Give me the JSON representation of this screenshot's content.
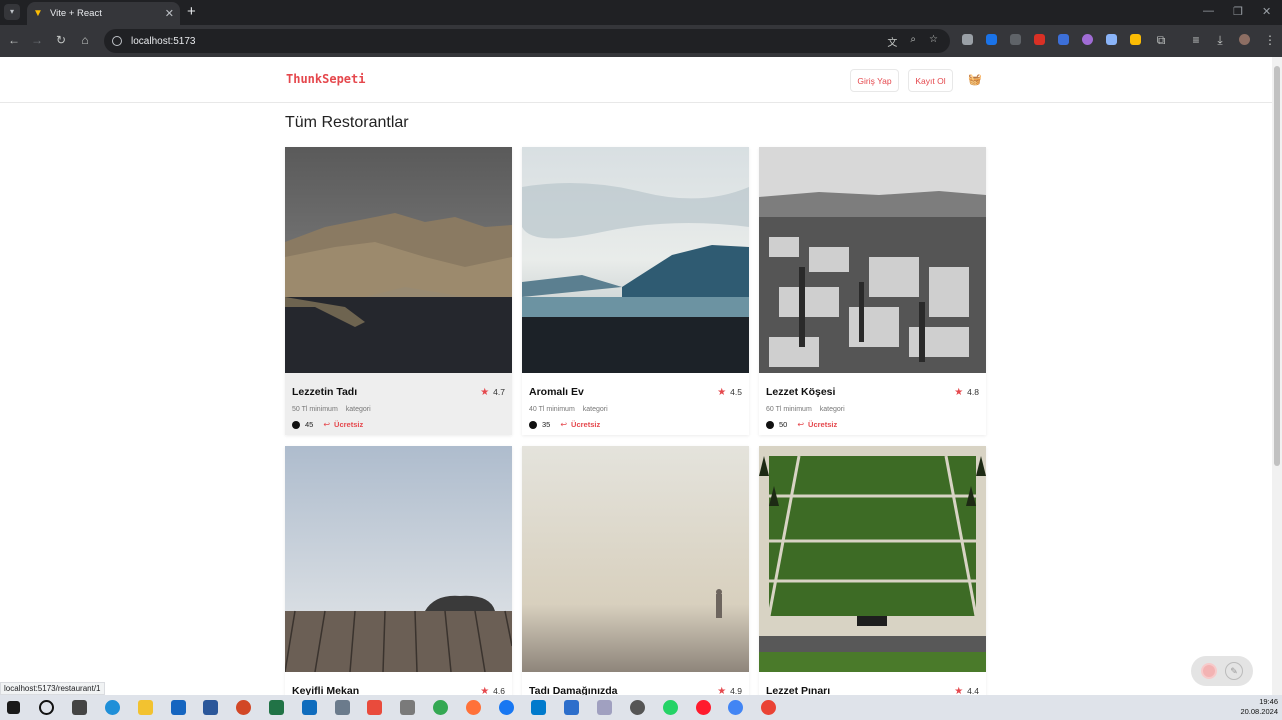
{
  "browser": {
    "tab_title": "Vite + React",
    "url": "localhost:5173",
    "status_url": "localhost:5173/restaurant/1"
  },
  "header": {
    "brand": "ThunkSepeti",
    "login_label": "Giriş Yap",
    "signup_label": "Kayıt Ol"
  },
  "main": {
    "title": "Tüm Restorantlar"
  },
  "restaurants": [
    {
      "name": "Lezzetin Tadı",
      "rating": "4.7",
      "min": "50 Tl minimum",
      "category": "kategori",
      "time": "45",
      "delivery": "Ücretsiz"
    },
    {
      "name": "Aromalı Ev",
      "rating": "4.5",
      "min": "40 Tl minimum",
      "category": "kategori",
      "time": "35",
      "delivery": "Ücretsiz"
    },
    {
      "name": "Lezzet Köşesi",
      "rating": "4.8",
      "min": "60 Tl minimum",
      "category": "kategori",
      "time": "50",
      "delivery": "Ücretsiz"
    },
    {
      "name": "Keyifli Mekan",
      "rating": "4.6"
    },
    {
      "name": "Tadı Damağınızda",
      "rating": "4.9"
    },
    {
      "name": "Lezzet Pınarı",
      "rating": "4.4"
    }
  ],
  "taskbar": {
    "time": "19:46",
    "date": "20.08.2024"
  },
  "colors": {
    "accent": "#e5484d",
    "chrome_dark": "#202124",
    "chrome_toolbar": "#35363a"
  }
}
